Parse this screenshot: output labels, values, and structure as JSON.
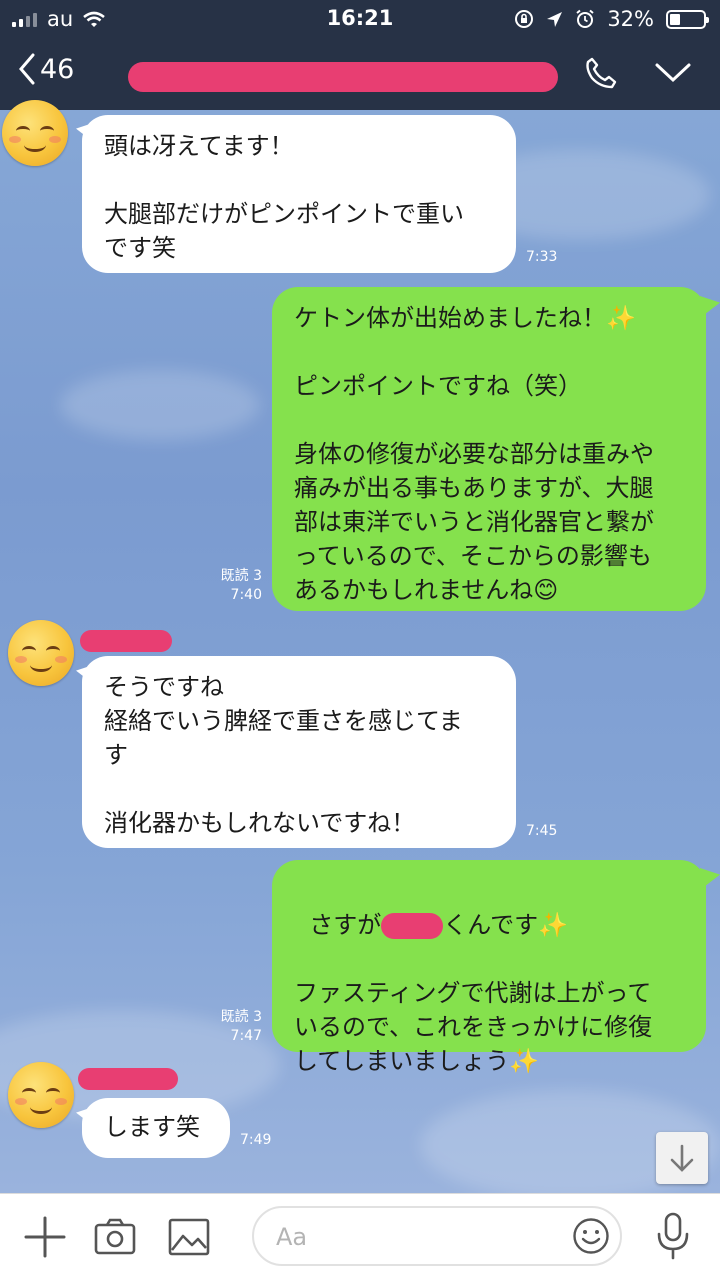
{
  "status_bar": {
    "carrier": "au",
    "time": "16:21",
    "battery": "32%",
    "battery_level": 0.32
  },
  "header": {
    "unread_count": "46"
  },
  "messages": [
    {
      "sender": "other",
      "text": "頭は冴えてます！\n\n大腿部だけがピンポイントで重い\nです笑",
      "time": "7:33"
    },
    {
      "sender": "me",
      "text": "ケトン体が出始めましたね！✨\n\nピンポイントですね（笑）\n\n身体の修復が必要な部分は重みや\n痛みが出る事もありますが、大腿\n部は東洋でいうと消化器官と繋が\nっているので、そこからの影響も\nあるかもしれませんね😊",
      "read": "既読 3",
      "time": "7:40"
    },
    {
      "sender": "other",
      "text": "そうですね\n経絡でいう脾経で重さを感じてま\nす\n\n消化器かもしれないですね！",
      "time": "7:45"
    },
    {
      "sender": "me",
      "text_before": "さすが",
      "text_after": "くんです",
      "text_rest": "ファスティングで代謝は上がって\nいるので、これをきっかけに修復\nしてしまいましょう",
      "read": "既読 3",
      "time": "7:47"
    },
    {
      "sender": "other",
      "text": "します笑",
      "time": "7:49"
    }
  ],
  "input": {
    "placeholder": "Aa"
  },
  "icons": [
    "back-chevron-icon",
    "phone-icon",
    "chevron-down-icon",
    "plus-icon",
    "camera-icon",
    "image-icon",
    "emoji-icon",
    "microphone-icon",
    "scroll-down-icon",
    "sparkle-icon"
  ]
}
